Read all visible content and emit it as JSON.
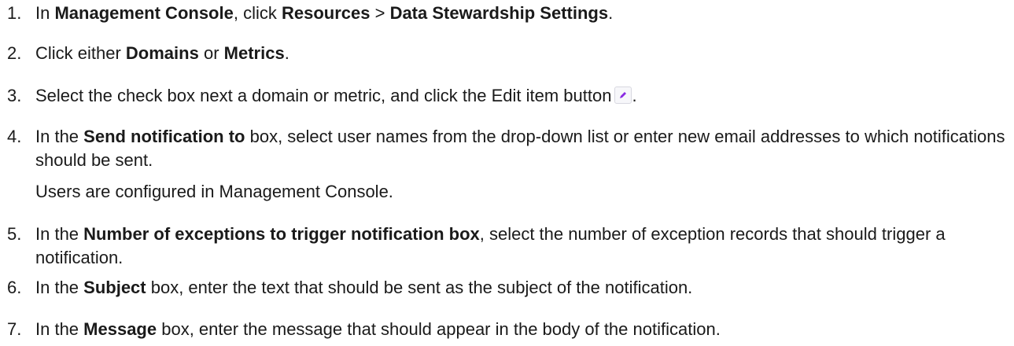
{
  "steps": [
    {
      "num": "1.",
      "parts": [
        {
          "t": "In ",
          "b": false
        },
        {
          "t": "Management Console",
          "b": true
        },
        {
          "t": ", click ",
          "b": false
        },
        {
          "t": "Resources",
          "b": true
        },
        {
          "t": " > ",
          "b": false
        },
        {
          "t": "Data Stewardship Settings",
          "b": true
        },
        {
          "t": ".",
          "b": false
        }
      ]
    },
    {
      "num": "2.",
      "parts": [
        {
          "t": "Click either ",
          "b": false
        },
        {
          "t": "Domains",
          "b": true
        },
        {
          "t": " or ",
          "b": false
        },
        {
          "t": "Metrics",
          "b": true
        },
        {
          "t": ".",
          "b": false
        }
      ]
    },
    {
      "num": "3.",
      "parts": [
        {
          "t": "Select the check box next a domain or metric, and click the Edit item button",
          "b": false
        },
        {
          "icon": "edit-pencil-icon"
        },
        {
          "t": ".",
          "b": false
        }
      ]
    },
    {
      "num": "4.",
      "parts": [
        {
          "t": "In the ",
          "b": false
        },
        {
          "t": "Send notification to",
          "b": true
        },
        {
          "t": " box, select user names from the drop-down list or enter new email addresses to which notifications should be sent.",
          "b": false
        }
      ],
      "note": "Users are configured in Management Console."
    },
    {
      "num": "5.",
      "parts": [
        {
          "t": "In the ",
          "b": false
        },
        {
          "t": "Number of exceptions to trigger notification box",
          "b": true
        },
        {
          "t": ", select the number of exception records that should trigger a notification.",
          "b": false
        }
      ]
    },
    {
      "num": "6.",
      "parts": [
        {
          "t": "In the ",
          "b": false
        },
        {
          "t": "Subject",
          "b": true
        },
        {
          "t": " box, enter the text that should be sent as the subject of the notification.",
          "b": false
        }
      ]
    },
    {
      "num": "7.",
      "parts": [
        {
          "t": "In the ",
          "b": false
        },
        {
          "t": "Message",
          "b": true
        },
        {
          "t": " box, enter the message that should appear in the body of the notification.",
          "b": false
        }
      ]
    }
  ],
  "colors": {
    "text": "#1a1a1a",
    "icon_accent": "#8a2be2"
  }
}
